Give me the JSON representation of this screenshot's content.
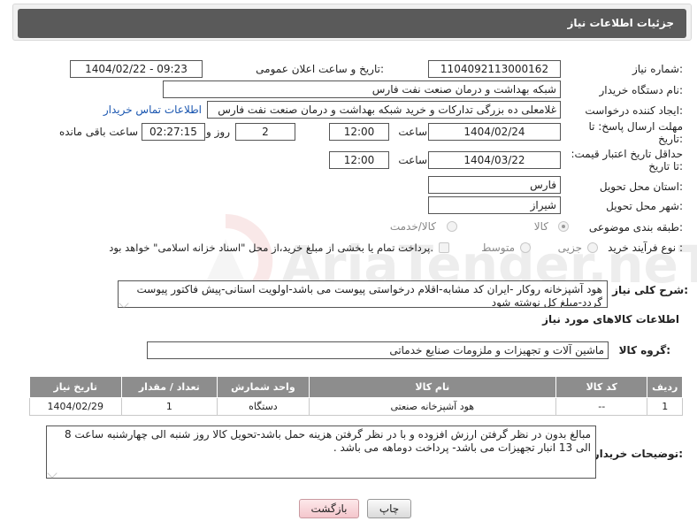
{
  "header": {
    "title": "جزئیات اطلاعات نیاز"
  },
  "watermark": {
    "text": "AriaTender.neT"
  },
  "fields": {
    "need_number_label": "شماره نیاز:",
    "need_number": "1104092113000162",
    "announce_label": "تاریخ و ساعت اعلان عمومی:",
    "announce_value": "1404/02/22 - 09:23",
    "buyer_label": "نام دستگاه خریدار:",
    "buyer_value": "شبکه بهداشت و درمان صنعت نفت فارس",
    "creator_label": "ایجاد کننده درخواست:",
    "creator_value": "غلامعلی ده بزرگی تدارکات و خرید شبکه بهداشت و درمان صنعت نفت فارس",
    "contact_link": "اطلاعات تماس خریدار",
    "deadline_label": "مهلت ارسال پاسخ: تا تاریخ:",
    "deadline_date": "1404/02/24",
    "time_label": "ساعت",
    "deadline_time": "12:00",
    "days_value": "2",
    "days_label": "روز و",
    "remaining_time": "02:27:15",
    "remaining_label": "ساعت باقی مانده",
    "price_label": "حداقل تاریخ اعتبار قیمت: تا تاریخ:",
    "price_date": "1404/03/22",
    "price_time_label": "ساعت",
    "price_time": "12:00",
    "province_label": "استان محل تحویل:",
    "province_value": "فارس",
    "city_label": "شهر محل تحویل:",
    "city_value": "شیراز",
    "category_label": "طبقه بندی موضوعی:",
    "category_options": [
      "کالا",
      "کالا/خدمت"
    ],
    "process_label": "نوع فرآیند خرید :",
    "process_options": [
      "جزیی",
      "متوسط"
    ],
    "payment_text": "پرداخت تمام یا بخشی از مبلغ خرید،از محل \"اسناد خزانه اسلامی\" خواهد بود."
  },
  "description": {
    "label": "شرح کلی نیاز:",
    "text": "هود آشپزخانه روکار -ایران کد مشابه-اقلام درخواستی پیوست می باشد-اولویت استانی-پیش فاکتور پیوست گردد-مبلغ کل نوشته شود"
  },
  "goods": {
    "section_title": "اطلاعات کالاهای مورد نیاز",
    "group_label": "گروه کالا:",
    "group_value": "ماشین آلات و تجهیزات و ملزومات صنایع خدماتی",
    "columns": [
      "ردیف",
      "کد کالا",
      "نام کالا",
      "واحد شمارش",
      "تعداد / مقدار",
      "تاریخ نیاز"
    ],
    "rows": [
      [
        "1",
        "--",
        "هود آشپزخانه صنعتی",
        "دستگاه",
        "1",
        "1404/02/29"
      ]
    ]
  },
  "buyer_notes": {
    "label": "توضیحات خریدار:",
    "text": "مبالغ بدون در نظر گرفتن ارزش افزوده و با در نظر گرفتن هزینه حمل باشد-تحویل کالا روز شنبه الی چهارشنبه ساعت 8 الی 13 انبار تجهیزات می باشد- پرداخت دوماهه می باشد ."
  },
  "buttons": {
    "print": "چاپ",
    "back": "بازگشت"
  }
}
